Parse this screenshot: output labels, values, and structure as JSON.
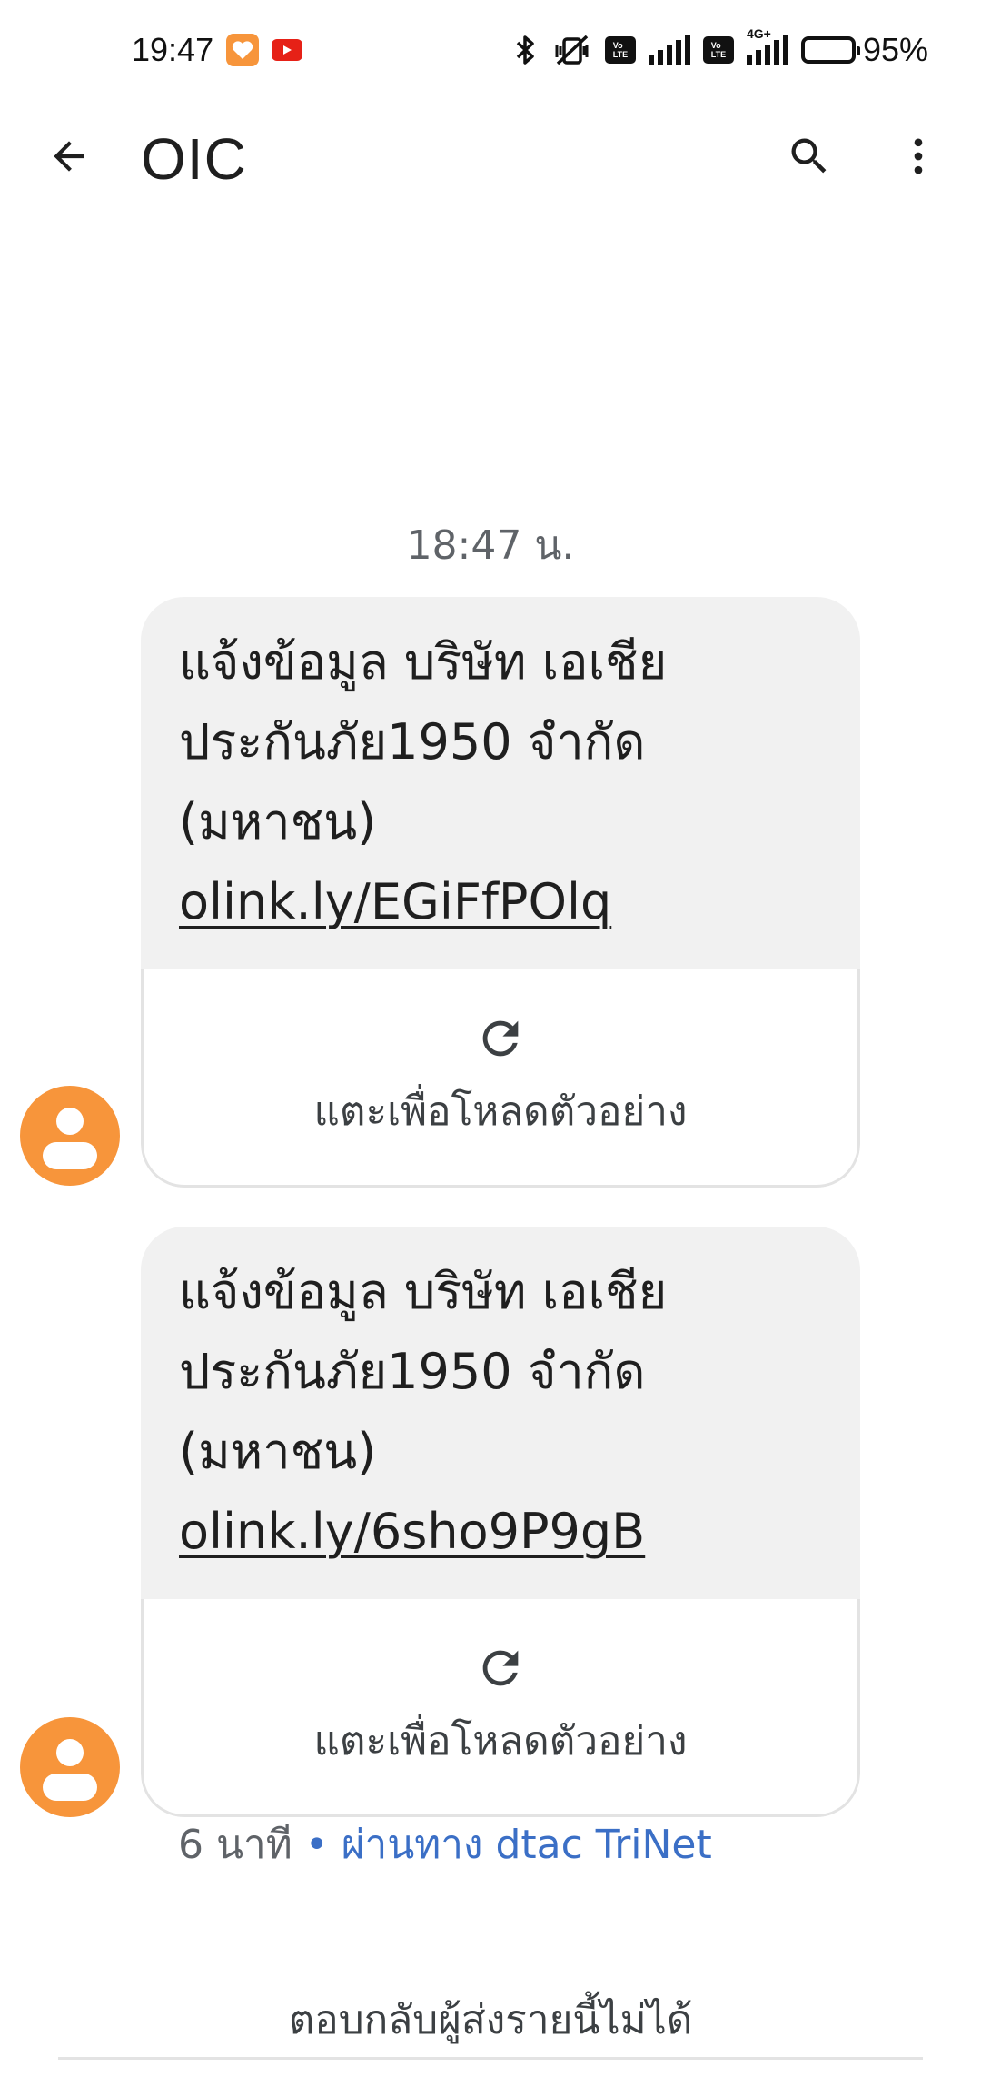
{
  "status_bar": {
    "time": "19:47",
    "network_label": "4G+",
    "battery_text": "95%",
    "battery_level_percent": 95
  },
  "toolbar": {
    "title": "OIC"
  },
  "conversation": {
    "timestamp": "18:47 น.",
    "messages": [
      {
        "text": "แจ้งข้อมูล บริษัท เอเชีย ประกันภัย1950 จำกัด (มหาชน) ",
        "link": "olink.ly/EGiFfPOlq",
        "preview_label": "แตะเพื่อโหลดตัวอย่าง"
      },
      {
        "text": "แจ้งข้อมูล บริษัท เอเชีย ประกันภัย1950 จำกัด (มหาชน) ",
        "link": "olink.ly/6sho9P9gB",
        "preview_label": "แตะเพื่อโหลดตัวอย่าง"
      }
    ],
    "meta": {
      "time_ago": "6 นาที",
      "separator": " • ",
      "via": "ผ่านทาง dtac TriNet"
    },
    "footer": "ตอบกลับผู้ส่งรายนี้ไม่ได้"
  },
  "colors": {
    "avatar": "#f7953b",
    "bubble": "#f1f1f1",
    "link_meta": "#3b6fc6",
    "youtube": "#e62117"
  },
  "icons": {
    "back": "arrow-back-icon",
    "search": "search-icon",
    "more": "more-vert-icon",
    "refresh": "refresh-icon",
    "avatar": "person-icon"
  }
}
